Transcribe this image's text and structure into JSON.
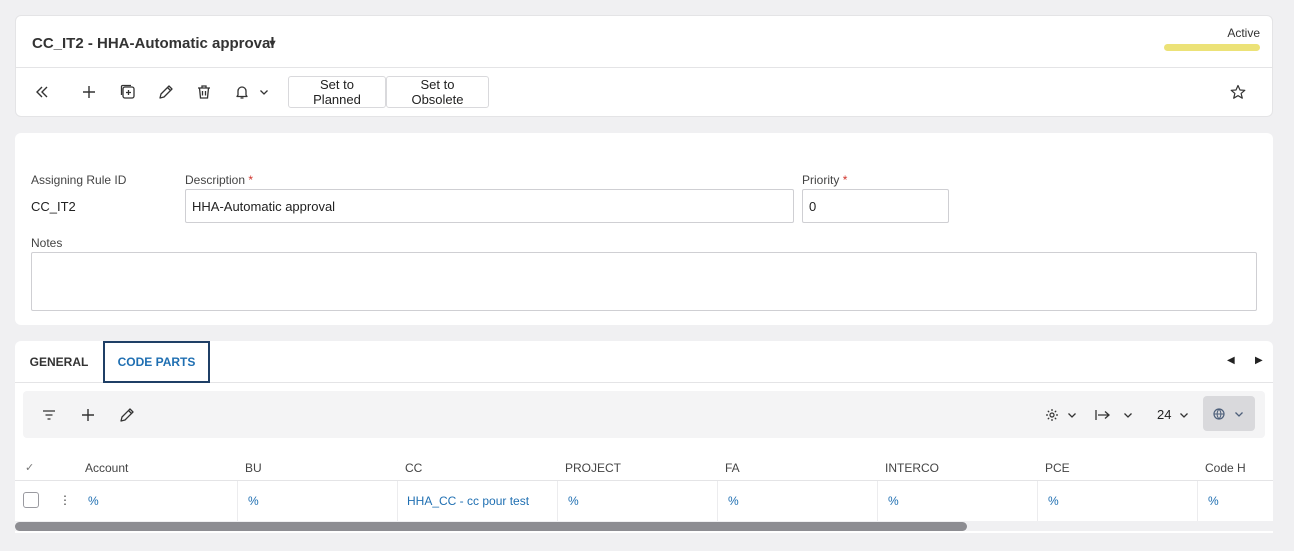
{
  "header": {
    "title": "CC_IT2 - HHA-Automatic approval",
    "title_caret_icon": "caret-down-icon",
    "status": "Active",
    "status_color": "#ece277"
  },
  "toolbar": {
    "icons": [
      "double-chevron-left-icon",
      "plus-icon",
      "duplicate-icon",
      "pencil-icon",
      "trash-icon",
      "bell-icon",
      "chevron-down-icon",
      "star-icon"
    ],
    "set_planned_label": "Set to Planned",
    "set_obsolete_label": "Set to Obsolete"
  },
  "form": {
    "rule_id_label": "Assigning Rule ID",
    "rule_id_value": "CC_IT2",
    "description_label": "Description",
    "description_value": "HHA-Automatic approval",
    "priority_label": "Priority",
    "priority_value": "0",
    "required_mark": "*",
    "notes_label": "Notes",
    "notes_value": ""
  },
  "tabs": {
    "items": [
      {
        "label": "GENERAL",
        "active": false
      },
      {
        "label": "CODE PARTS",
        "active": true
      }
    ],
    "accent_color": "#1f6fb2"
  },
  "grid": {
    "toolbar": {
      "icons": [
        "filter-icon",
        "plus-icon",
        "pencil-icon",
        "gear-icon",
        "arrow-right-to-line-icon",
        "globe-icon"
      ],
      "page_size": "24"
    },
    "columns": [
      "Account",
      "BU",
      "CC",
      "PROJECT",
      "FA",
      "INTERCO",
      "PCE",
      "Code H"
    ],
    "rows": [
      [
        "%",
        "%",
        "HHA_CC - cc pour test",
        "%",
        "%",
        "%",
        "%",
        "%"
      ]
    ],
    "row_menu_glyph": "⋮",
    "header_check_glyph": "✓",
    "horizontal_scroll_position": 0
  }
}
